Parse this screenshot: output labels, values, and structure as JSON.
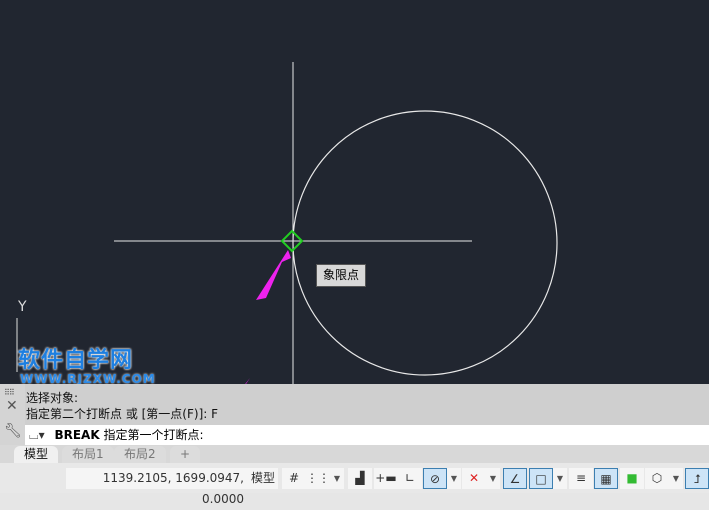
{
  "canvas": {
    "background": "#212630",
    "tooltip": "象限点",
    "ucs_axis_label": "Y",
    "snap_marker_color": "#22cc22",
    "arrow_color": "#ee22ee"
  },
  "watermark": {
    "line1": "软件自学网",
    "line2": "WWW.RJZXW.COM"
  },
  "command": {
    "history": [
      "选择对象:",
      "指定第二个打断点 或 [第一点(F)]: F"
    ],
    "command_name": "BREAK",
    "prompt": "指定第一个打断点:"
  },
  "tabs": [
    {
      "label": "模型",
      "active": true
    },
    {
      "label": "布局1"
    },
    {
      "label": "布局2"
    },
    {
      "label": "+"
    }
  ],
  "status": {
    "coordinates": "1139.2105, 1699.0947, 0.0000",
    "model_label": "模型",
    "buttons": [
      {
        "icon": "grid-icon"
      },
      {
        "icon": "snap-mode-icon"
      },
      {
        "icon": "infer-constraints-icon"
      },
      {
        "icon": "dynamic-input-icon"
      },
      {
        "icon": "ortho-icon"
      },
      {
        "icon": "polar-tracking-icon",
        "on": true
      },
      {
        "icon": "isometric-icon"
      },
      {
        "icon": "object-snap-tracking-icon",
        "on": true
      },
      {
        "icon": "object-snap-icon",
        "on": true
      },
      {
        "icon": "lineweight-icon"
      },
      {
        "icon": "transparency-icon",
        "on": true
      },
      {
        "icon": "selection-cycling-icon"
      },
      {
        "icon": "3d-osnap-icon"
      },
      {
        "icon": "dynamic-ucs-icon",
        "on": true
      }
    ]
  }
}
